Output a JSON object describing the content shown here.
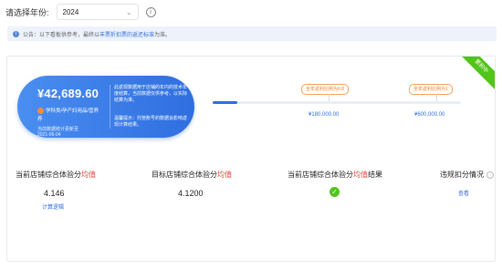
{
  "filter": {
    "label": "请选择年份:",
    "year": "2024"
  },
  "notice": {
    "prefix": "公告：以下看板供参考，最终以",
    "link": "丰票折扣票的返还标准",
    "suffix": "为准。"
  },
  "status_ribbon": "累积中",
  "card": {
    "amount": "¥42,689.60",
    "category": "学科类/孕产妇用品/营养",
    "category_cont": "养",
    "data_label": "当前数据统计更新至",
    "data_date": "2021-06-04",
    "desc": "此返现数据用于店铺的年内的技术年度结算，当前数据仅供参考，以实际结算为准。",
    "desc2": "温馨提示：托管账号的数据会影响返现计算结果。"
  },
  "progress": {
    "fill_ratio": 0.1,
    "tip1": "全年返利比例为0.8",
    "tip2": "全年返利比例为1",
    "milestone1": "¥180,000.00",
    "milestone2": "¥600,000.00"
  },
  "metrics": {
    "m1_label_a": "当前店铺综合体验分",
    "m1_label_b": "均值",
    "m1_value": "4.146",
    "m1_link": "计算逻辑",
    "m2_label_a": "目标店铺综合体验分",
    "m2_label_b": "均值",
    "m2_value": "4.1200",
    "m3_label_a": "当前店铺综合体验分",
    "m3_label_b": "均值",
    "m3_label_c": "结果",
    "m4_label": "违规扣分情况",
    "m4_link": "查看"
  },
  "colors": {
    "accent": "#2f6ee0",
    "green": "#52c41a",
    "red": "#e8463a",
    "orange": "#f07b2a"
  }
}
